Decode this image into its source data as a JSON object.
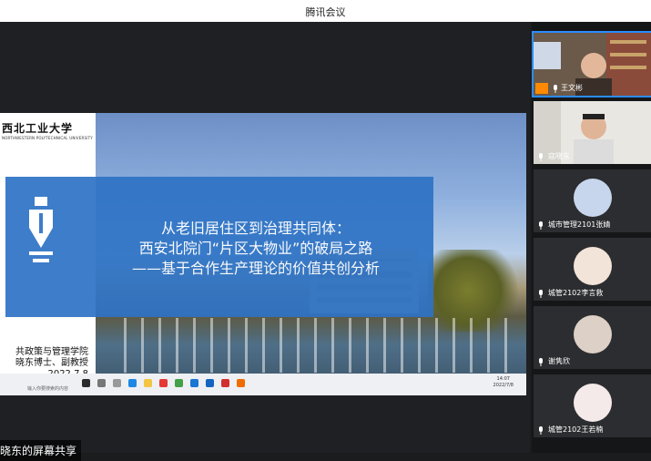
{
  "window": {
    "title": "腾讯会议"
  },
  "slide": {
    "logo_cn": "西北工业大学",
    "logo_en": "NORTHWESTERN POLYTECHNICAL UNIVERSITY",
    "title_lines": [
      "从老旧居住区到治理共同体：",
      "西安北院门“片区大物业”的破局之路",
      "——基于合作生产理论的价值共创分析"
    ],
    "affiliation_lines": [
      "共政策与管理学院",
      "晓东博士、副教授",
      "2022.7.8"
    ],
    "taskbar_clock_time": "14:07",
    "taskbar_clock_date": "2022/7/8",
    "taskbar_search": "输入你要搜索的内容"
  },
  "share_label": "晓东的屏幕共享",
  "participants": [
    {
      "name": "王文彬",
      "kind": "video",
      "host": true
    },
    {
      "name": "寇晓东",
      "kind": "video",
      "host": false
    },
    {
      "name": "城市管理2101张婧",
      "kind": "avatar",
      "host": false
    },
    {
      "name": "城管2102李言救",
      "kind": "avatar",
      "host": false
    },
    {
      "name": "谢隽欣",
      "kind": "avatar",
      "host": false
    },
    {
      "name": "城管2102王若楠",
      "kind": "avatar",
      "host": false
    }
  ],
  "icons": {
    "mic": "microphone-icon",
    "host": "host-badge-icon",
    "banner": "pen-nib-icon"
  },
  "colors": {
    "accent": "#2e73c5",
    "titlebar": "#ffffff",
    "sidebar_bg": "#151618"
  }
}
